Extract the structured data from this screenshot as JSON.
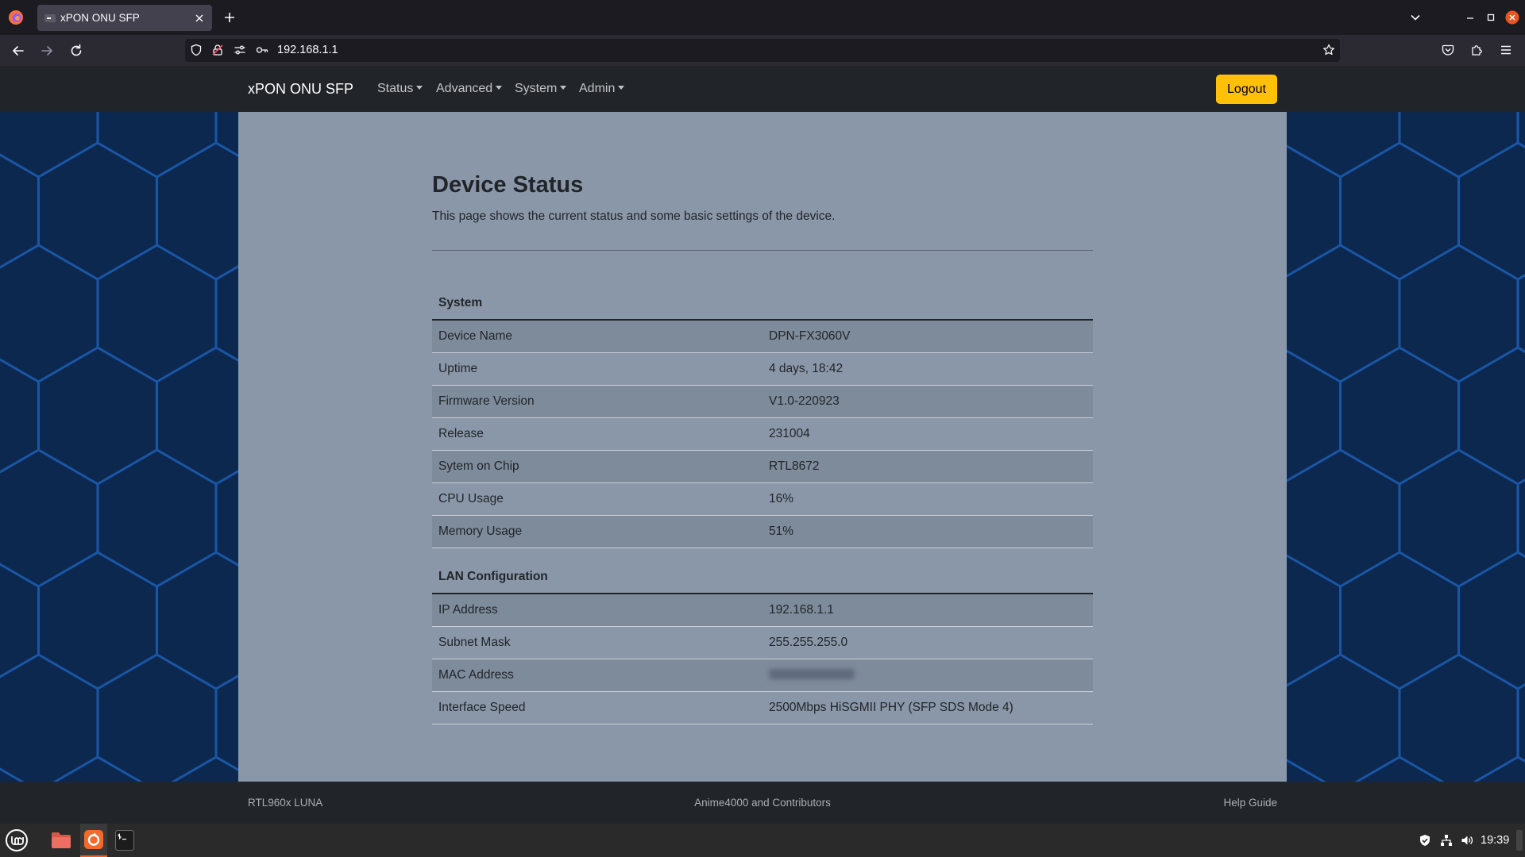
{
  "browser": {
    "tab_title": "xPON ONU SFP",
    "url": "192.168.1.1",
    "icons": [
      "firefox-app-icon",
      "tab-favicon-icon",
      "tab-close-icon",
      "new-tab-plus-icon",
      "list-all-tabs-chevron-icon",
      "window-minimize-icon",
      "window-maximize-icon",
      "window-close-icon",
      "back-arrow-icon",
      "forward-arrow-icon",
      "reload-icon",
      "tracking-protection-shield-icon",
      "insecure-lock-icon",
      "permissions-icon",
      "saved-logins-key-icon",
      "bookmark-star-icon",
      "pocket-icon",
      "extensions-puzzle-icon",
      "hamburger-menu-icon"
    ]
  },
  "navbar": {
    "brand": "xPON ONU SFP",
    "menus": [
      {
        "label": "Status"
      },
      {
        "label": "Advanced"
      },
      {
        "label": "System"
      },
      {
        "label": "Admin"
      }
    ],
    "logout_label": "Logout"
  },
  "page": {
    "title": "Device Status",
    "description": "This page shows the current status and some basic settings of the device."
  },
  "sections": [
    {
      "title": "System",
      "rows": [
        {
          "label": "Device Name",
          "value": "DPN-FX3060V"
        },
        {
          "label": "Uptime",
          "value": "4 days, 18:42"
        },
        {
          "label": "Firmware Version",
          "value": "V1.0-220923"
        },
        {
          "label": "Release",
          "value": "231004"
        },
        {
          "label": "Sytem on Chip",
          "value": "RTL8672"
        },
        {
          "label": "CPU Usage",
          "value": "16%"
        },
        {
          "label": "Memory Usage",
          "value": "51%"
        }
      ]
    },
    {
      "title": "LAN Configuration",
      "rows": [
        {
          "label": "IP Address",
          "value": "192.168.1.1"
        },
        {
          "label": "Subnet Mask",
          "value": "255.255.255.0"
        },
        {
          "label": "MAC Address",
          "value_blurred": true
        },
        {
          "label": "Interface Speed",
          "value": "2500Mbps HiSGMII PHY (SFP SDS Mode 4)"
        }
      ]
    }
  ],
  "footer": {
    "left": "RTL960x LUNA",
    "center": "Anime4000 and Contributors",
    "right": "Help Guide"
  },
  "taskbar": {
    "clock": "19:39",
    "icons": [
      "mint-menu-icon",
      "files-folder-icon",
      "firefox-taskbar-icon",
      "terminal-icon",
      "security-shield-tray-icon",
      "network-tray-icon",
      "volume-tray-icon"
    ]
  },
  "colors": {
    "accent": "#ffc107",
    "navbar_bg": "#212529",
    "panel_bg": "#8a97a8",
    "row_stripe": "#7e8b9b",
    "page_bg": "#0c284f",
    "hex_stroke": "#1a56a6",
    "text": "#212529"
  }
}
